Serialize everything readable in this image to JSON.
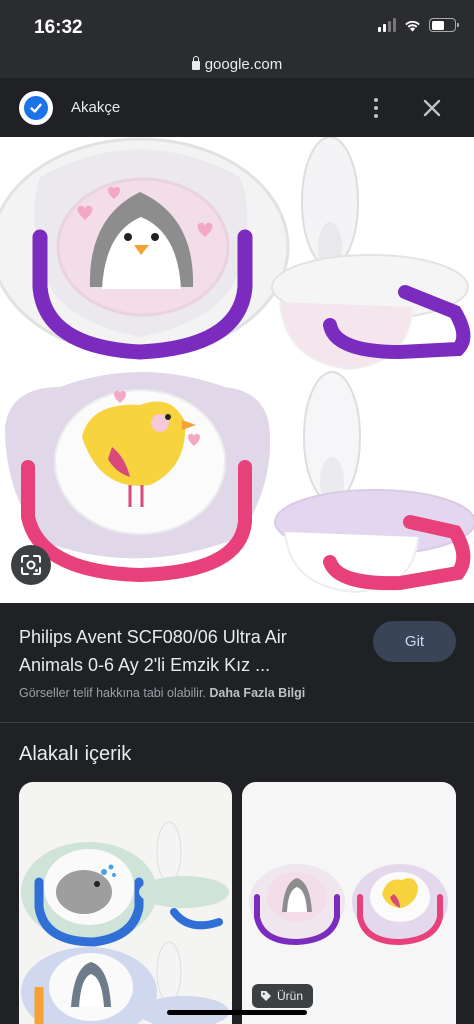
{
  "status_bar": {
    "time": "16:32"
  },
  "url_bar": {
    "domain": "google.com"
  },
  "header": {
    "site_name": "Akakçe"
  },
  "product": {
    "title": "Philips Avent SCF080/06 Ultra Air Animals 0-6 Ay 2'li Emzik Kız ...",
    "go_label": "Git",
    "copyright_text": "Görseller telif hakkına tabi olabilir.",
    "more_info_label": "Daha Fazla Bilgi"
  },
  "related": {
    "heading": "Alakalı içerik",
    "badge_label": "Ürün"
  },
  "colors": {
    "background": "#202124",
    "purple": "#7b2cbf",
    "pink": "#e8407a",
    "button_bg": "#394457"
  },
  "icons": [
    "signal-icon",
    "wifi-icon",
    "battery-icon",
    "lock-icon",
    "verified-check-icon",
    "more-vert-icon",
    "close-icon",
    "google-lens-icon",
    "tag-icon"
  ]
}
